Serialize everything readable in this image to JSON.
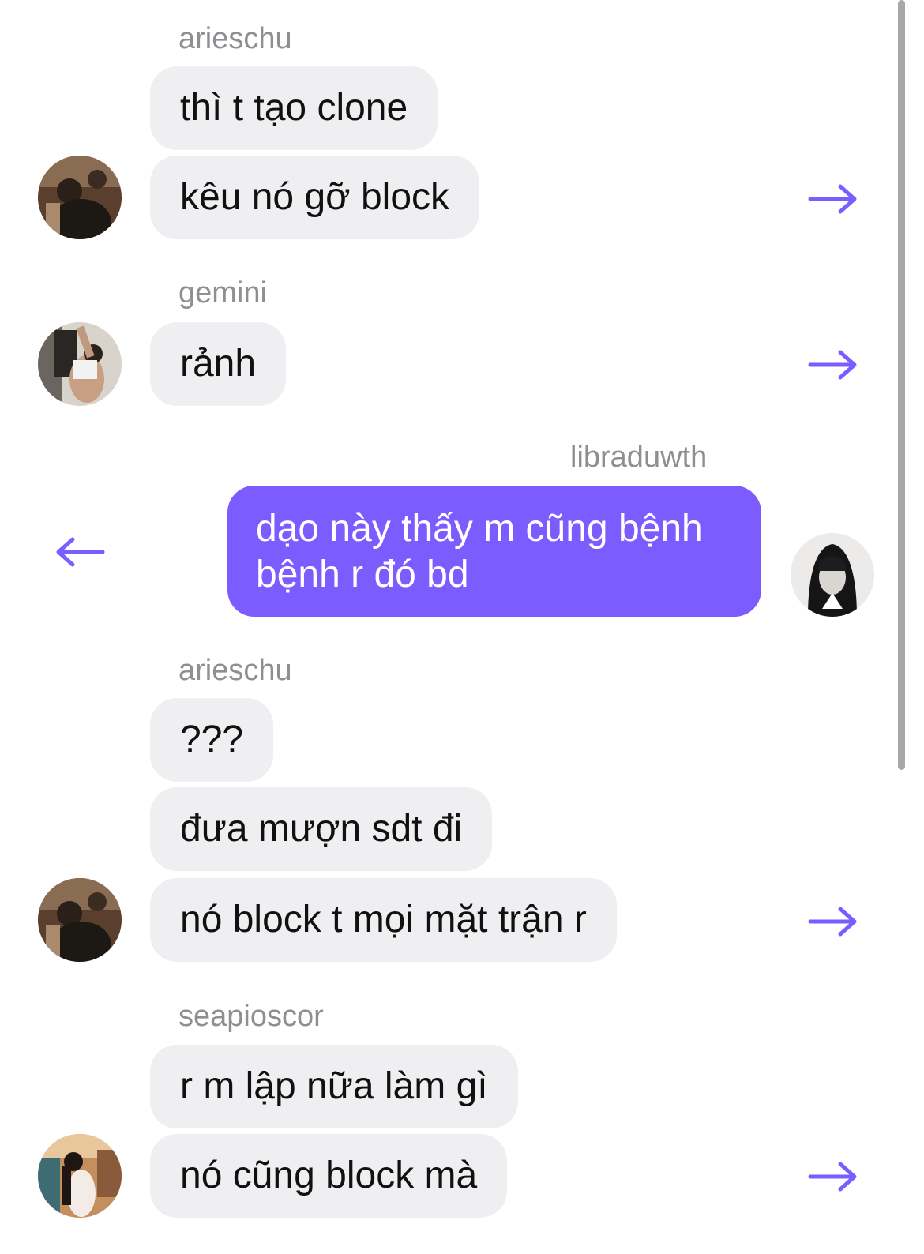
{
  "messages": [
    {
      "sender": "arieschu",
      "bubbles": [
        "thì t tạo clone",
        "kêu nó gỡ block"
      ],
      "avatar": "avatar-arieschu"
    },
    {
      "sender": "gemini",
      "bubbles": [
        "rảnh"
      ],
      "avatar": "avatar-gemini"
    },
    {
      "sender": "libraduwth",
      "bubbles": [
        "dạo này thấy m cũng bệnh bệnh r đó bd"
      ],
      "avatar": "avatar-libraduwth",
      "mine": true
    },
    {
      "sender": "arieschu",
      "bubbles": [
        "???",
        "đưa mượn sdt đi",
        "nó block t mọi mặt trận r"
      ],
      "avatar": "avatar-arieschu"
    },
    {
      "sender": "seapioscor",
      "bubbles": [
        "r m lập nữa làm gì",
        "nó cũng block mà"
      ],
      "avatar": "avatar-seapioscor"
    }
  ],
  "colors": {
    "accent": "#7b5cff",
    "bubble_bg": "#efeff1",
    "sender_text": "#8e8e93"
  },
  "icons": {
    "forward": "arrow-right-icon",
    "reply": "arrow-left-icon"
  }
}
